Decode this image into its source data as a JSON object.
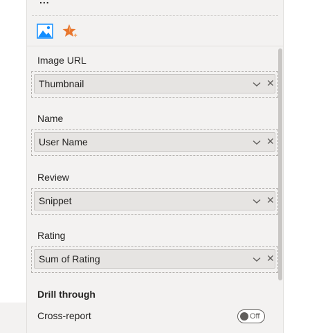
{
  "pane": {
    "more_label": "...",
    "viz_icons": [
      {
        "icon": "image-chart-icon",
        "title": "Image"
      },
      {
        "icon": "star-spark-icon",
        "title": "Rating"
      }
    ],
    "wells": [
      {
        "label": "Image URL",
        "field": "Thumbnail"
      },
      {
        "label": "Name",
        "field": "User Name"
      },
      {
        "label": "Review",
        "field": "Snippet"
      },
      {
        "label": "Rating",
        "field": "Sum of Rating"
      }
    ],
    "drill_through": {
      "title": "Drill through",
      "cross_report_label": "Cross-report",
      "cross_report_state": "Off"
    }
  },
  "colors": {
    "pane_bg": "#f3f2f1",
    "pill_bg": "#e6e4e2",
    "accent_blue": "#118dff",
    "accent_orange": "#e8762d"
  }
}
